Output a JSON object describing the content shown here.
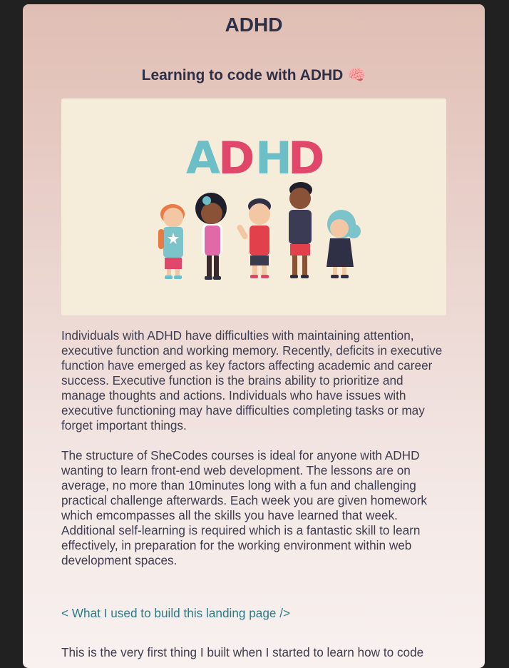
{
  "page": {
    "title": "ADHD",
    "subtitle": "Learning to code with ADHD",
    "subtitle_emoji": "🧠"
  },
  "hero_image": {
    "heading_text": "ADHD",
    "letter_colors": [
      "#6cbfc7",
      "#e0476a",
      "#6cbfc7",
      "#e0476a"
    ],
    "background": "#f5ecd9"
  },
  "content": {
    "paragraph_1": "Individuals with ADHD have difficulties with maintaining attention, executive function and working memory. Recently, deficits in executive function have emerged as key factors affecting academic and career success. Executive function is the brains ability to prioritize and manage thoughts and actions. Individuals who have issues with executive functioning may have difficulties completing tasks or may forget important things.",
    "paragraph_2": "The structure of SheCodes courses is ideal for anyone with ADHD wanting to learn front-end web development. The lessons are on average, no more than 10minutes long with a fun and challenging practical challenge afterwards. Each week you are given homework which emcompasses all the skills you have learned that week. Additional self-learning is required which is a fantastic skill to learn effectively, in preparation for the working environment within web development spaces.",
    "link_text": "< What I used to build this landing page />",
    "paragraph_3": "This is the very first thing I built when I started to learn how to code"
  },
  "colors": {
    "page_background": "#212121",
    "card_top": "#e0beb4",
    "card_bottom": "#f8f1ef",
    "heading": "#2f2f45",
    "body_text": "#3d3d4f",
    "link": "#2a7b86"
  }
}
